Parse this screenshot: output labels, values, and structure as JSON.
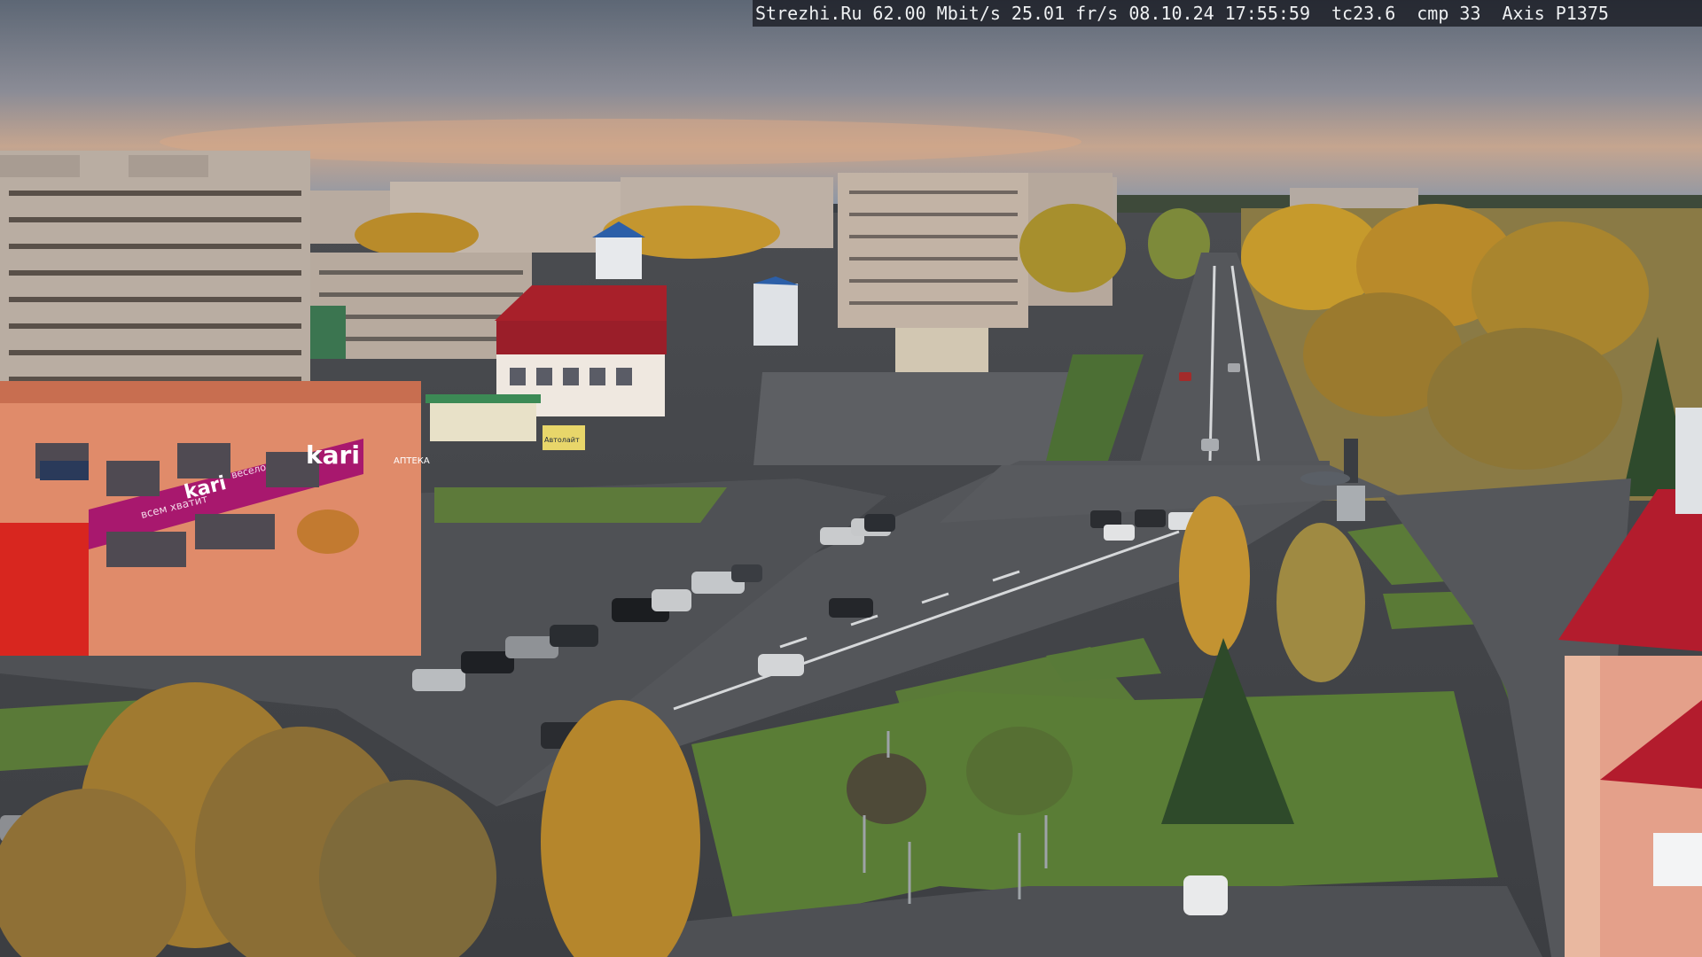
{
  "overlay": {
    "site": "Strezhi.Ru",
    "bitrate": "62.00 Mbit/s",
    "framerate": "25.01 fr/s",
    "date": "08.10.24",
    "time": "17:55:59",
    "tc": "tc23.6",
    "cmp": "cmp 33",
    "camera": "Axis P1375"
  },
  "signs": {
    "kari_main": "kari",
    "kari_small": "kari",
    "kari_tagline": "всем хватит",
    "kari_tagline2": "весело",
    "store_label": "АПТЕКА",
    "panel_label": "Автолайт"
  },
  "scene": {
    "sky_top": "#5f6a78",
    "sky_glow": "#c99a7d",
    "kari_brand": "#a8186e",
    "roof_red": "#a8202a",
    "foliage": "#b98a2a"
  }
}
